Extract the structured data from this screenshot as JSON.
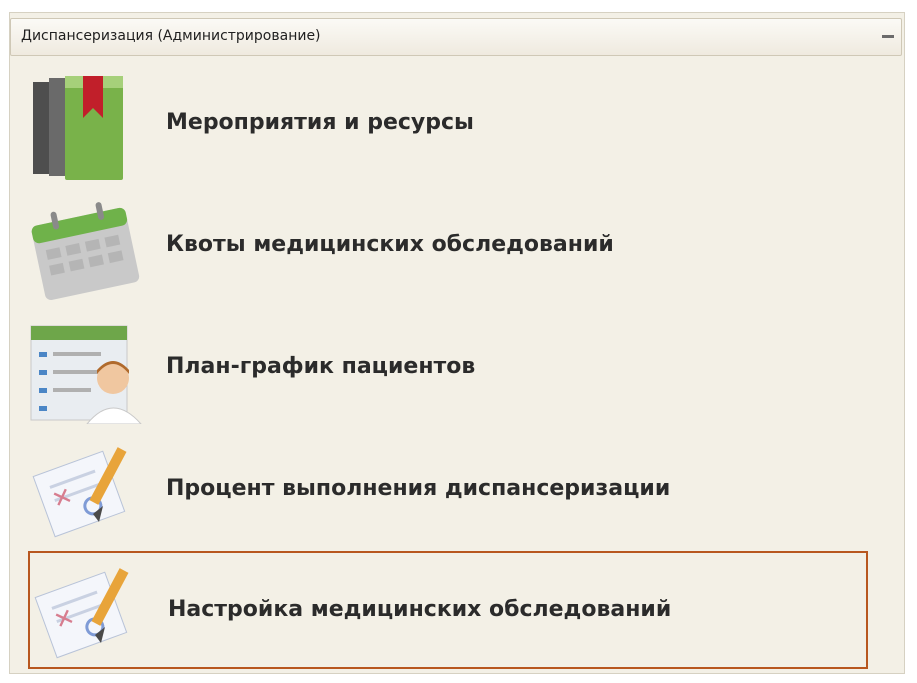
{
  "panel": {
    "title": "Диспансеризация (Администрирование)",
    "items": [
      {
        "label": "Мероприятия и ресурсы",
        "icon": "books-icon"
      },
      {
        "label": "Квоты медицинских обследований",
        "icon": "calendar-icon"
      },
      {
        "label": "План-график пациентов",
        "icon": "patient-list-icon"
      },
      {
        "label": "Процент выполнения диспансеризации",
        "icon": "document-pencil-icon"
      },
      {
        "label": "Настройка медицинских обследований",
        "icon": "document-pencil-icon",
        "selected": true
      }
    ]
  },
  "colors": {
    "panel_background": "#f3f0e6",
    "selection_border": "#b8571f"
  }
}
